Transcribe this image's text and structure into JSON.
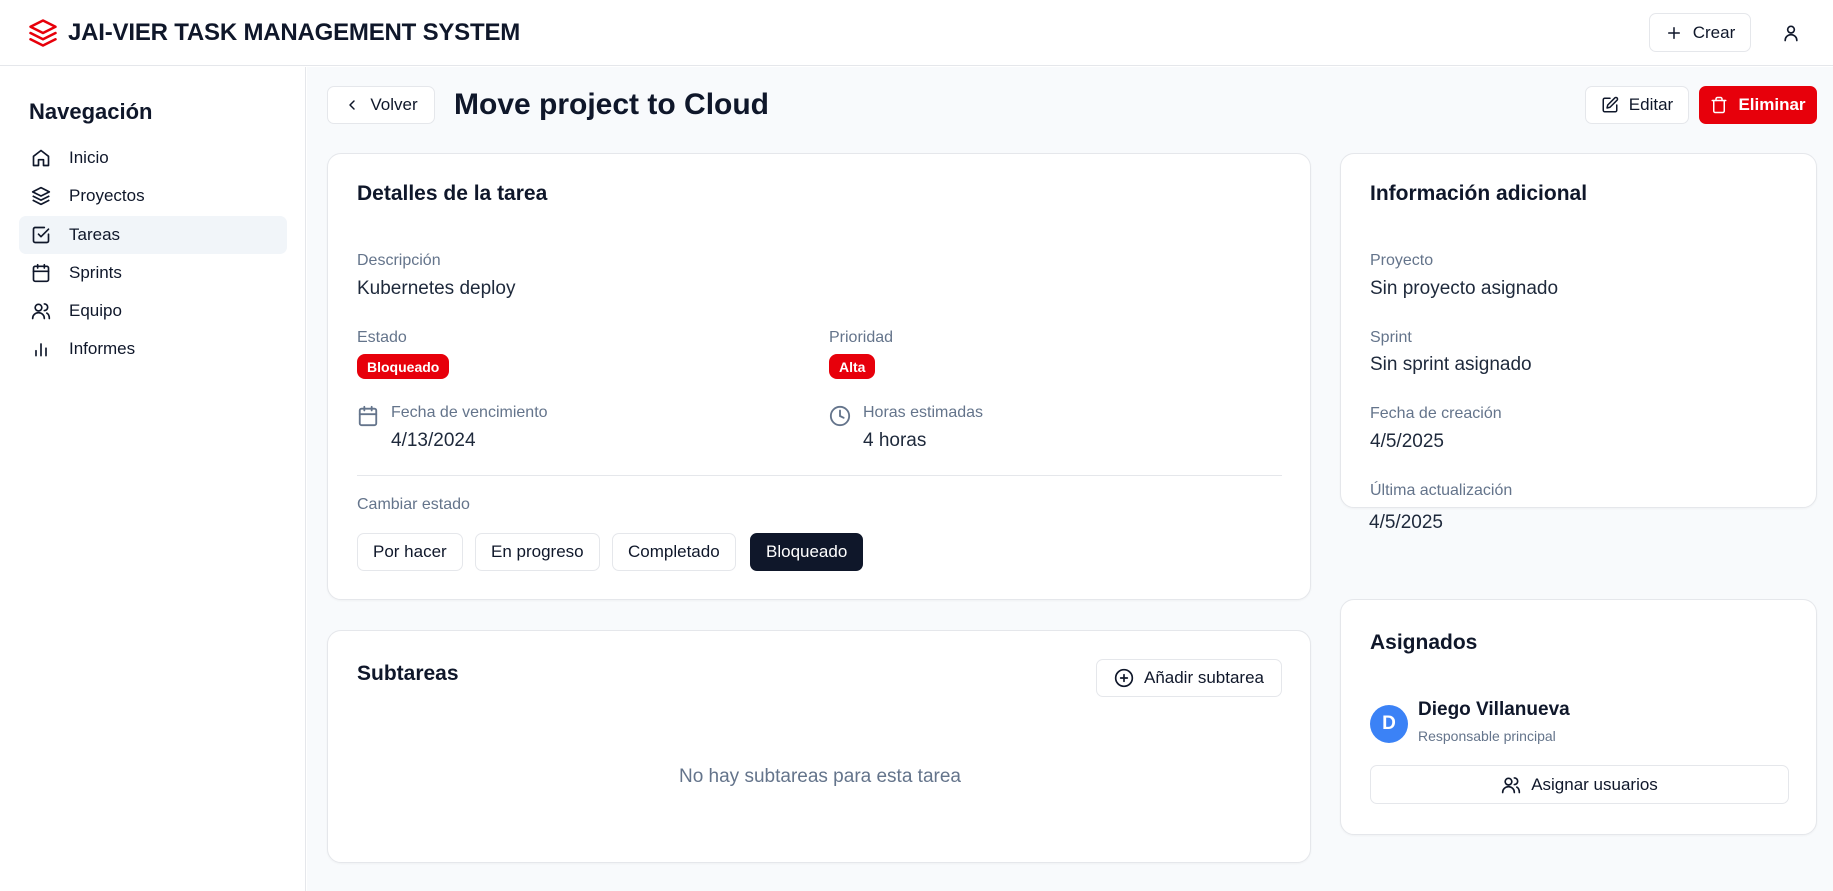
{
  "app": {
    "title": "JAI-VIER TASK MANAGEMENT SYSTEM",
    "brand_color": "#e7000b"
  },
  "header": {
    "create_label": "Crear"
  },
  "sidebar": {
    "title": "Navegación",
    "items": [
      {
        "label": "Inicio",
        "icon": "home-icon",
        "active": false
      },
      {
        "label": "Proyectos",
        "icon": "layers-icon",
        "active": false
      },
      {
        "label": "Tareas",
        "icon": "check-square-icon",
        "active": true
      },
      {
        "label": "Sprints",
        "icon": "calendar-icon",
        "active": false
      },
      {
        "label": "Equipo",
        "icon": "users-icon",
        "active": false
      },
      {
        "label": "Informes",
        "icon": "bar-chart-icon",
        "active": false
      }
    ]
  },
  "page": {
    "back_label": "Volver",
    "title": "Move project to Cloud",
    "edit_label": "Editar",
    "delete_label": "Eliminar"
  },
  "details": {
    "title": "Detalles de la tarea",
    "description_label": "Descripción",
    "description": "Kubernetes deploy",
    "status_label": "Estado",
    "status": "Bloqueado",
    "priority_label": "Prioridad",
    "priority": "Alta",
    "due_label": "Fecha de vencimiento",
    "due_date": "4/13/2024",
    "hours_label": "Horas estimadas",
    "hours": "4 horas",
    "change_status_label": "Cambiar estado",
    "status_options": [
      "Por hacer",
      "En progreso",
      "Completado",
      "Bloqueado"
    ],
    "selected_status": "Bloqueado"
  },
  "subtasks": {
    "title": "Subtareas",
    "add_label": "Añadir subtarea",
    "empty_text": "No hay subtareas para esta tarea"
  },
  "info": {
    "title": "Información adicional",
    "project_label": "Proyecto",
    "project": "Sin proyecto asignado",
    "sprint_label": "Sprint",
    "sprint": "Sin sprint asignado",
    "created_label": "Fecha de creación",
    "created": "4/5/2025",
    "updated_label": "Última actualización",
    "updated": "4/5/2025"
  },
  "assignees": {
    "title": "Asignados",
    "people": [
      {
        "initial": "D",
        "name": "Diego Villanueva",
        "role": "Responsable principal",
        "avatar_color": "#3b82f6"
      }
    ],
    "assign_label": "Asignar usuarios"
  }
}
